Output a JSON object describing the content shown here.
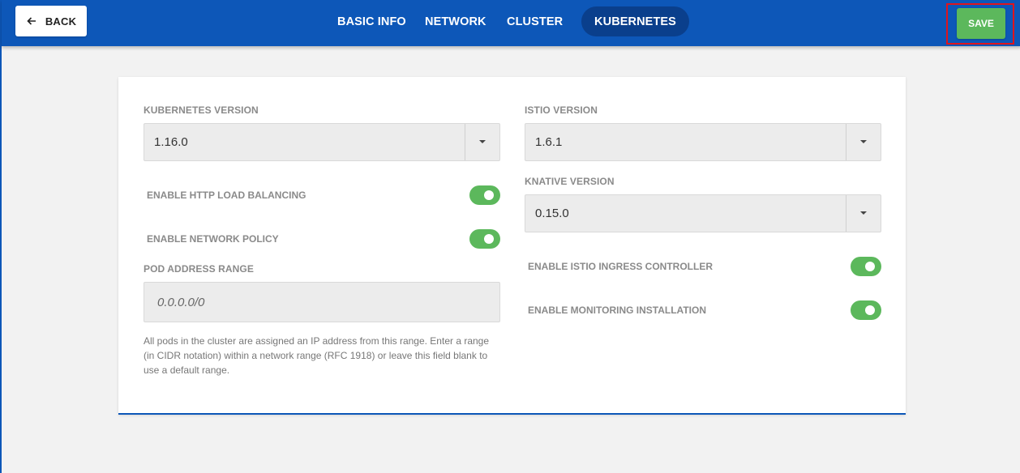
{
  "header": {
    "back_label": "BACK",
    "tabs": [
      {
        "label": "BASIC INFO",
        "active": false
      },
      {
        "label": "NETWORK",
        "active": false
      },
      {
        "label": "CLUSTER",
        "active": false
      },
      {
        "label": "KUBERNETES",
        "active": true
      }
    ],
    "save_label": "SAVE"
  },
  "form": {
    "kubernetes_version": {
      "label": "KUBERNETES VERSION",
      "value": "1.16.0"
    },
    "istio_version": {
      "label": "ISTIO VERSION",
      "value": "1.6.1"
    },
    "knative_version": {
      "label": "KNATIVE VERSION",
      "value": "0.15.0"
    },
    "http_load_balancing": {
      "label": "ENABLE HTTP LOAD BALANCING",
      "enabled": true
    },
    "network_policy": {
      "label": "ENABLE NETWORK POLICY",
      "enabled": true
    },
    "istio_ingress": {
      "label": "ENABLE ISTIO INGRESS CONTROLLER",
      "enabled": true
    },
    "monitoring": {
      "label": "ENABLE MONITORING INSTALLATION",
      "enabled": true
    },
    "pod_address_range": {
      "label": "POD ADDRESS RANGE",
      "value": "",
      "placeholder": "0.0.0.0/0",
      "help": "All pods in the cluster are assigned an IP address from this range. Enter a range (in CIDR notation) within a network range (RFC 1918) or leave this field blank to use a default range."
    }
  },
  "colors": {
    "primary": "#0d57b8",
    "active_tab": "#0a3f8c",
    "success": "#5cb85c",
    "highlight_border": "#e0141c"
  },
  "icons": {
    "back": "arrow-left-icon",
    "dropdown": "caret-down-icon"
  }
}
